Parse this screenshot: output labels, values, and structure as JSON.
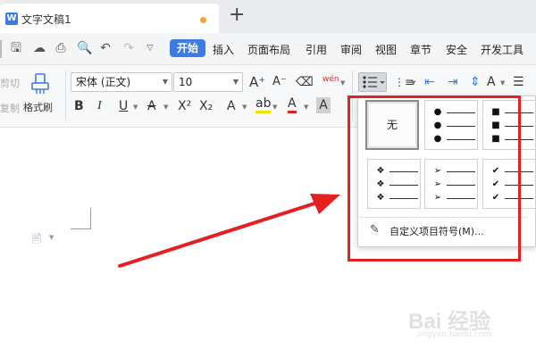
{
  "titlebar": {
    "doc_title": "文字文稿1",
    "new_tab_symbol": "+"
  },
  "menu": {
    "items": [
      "开始",
      "插入",
      "页面布局",
      "引用",
      "审阅",
      "视图",
      "章节",
      "安全",
      "开发工具"
    ],
    "active": "开始"
  },
  "ribbon": {
    "clipped_label_top": "剪切",
    "clipped_label_bottom": "复制",
    "format_painter": "格式刷",
    "font_name": "宋体 (正文)",
    "font_size": "10",
    "phonetic_label": "wén"
  },
  "dropdown": {
    "none_label": "无",
    "custom_label": "自定义项目符号(M)...",
    "bullet_styles": [
      {
        "name": "none"
      },
      {
        "name": "filled-circle",
        "glyph": "●"
      },
      {
        "name": "filled-square",
        "glyph": "■"
      },
      {
        "name": "diamond-cluster",
        "glyph": "❖"
      },
      {
        "name": "arrowhead",
        "glyph": "➢"
      },
      {
        "name": "checkmark",
        "glyph": "✔"
      }
    ]
  },
  "watermark": {
    "line1": "Bai  经验",
    "line2": "jingyan.baidu.com"
  },
  "colors": {
    "accent": "#3b7be4",
    "annotation_red": "#e52020",
    "unsaved_dot": "#f0a33a"
  }
}
